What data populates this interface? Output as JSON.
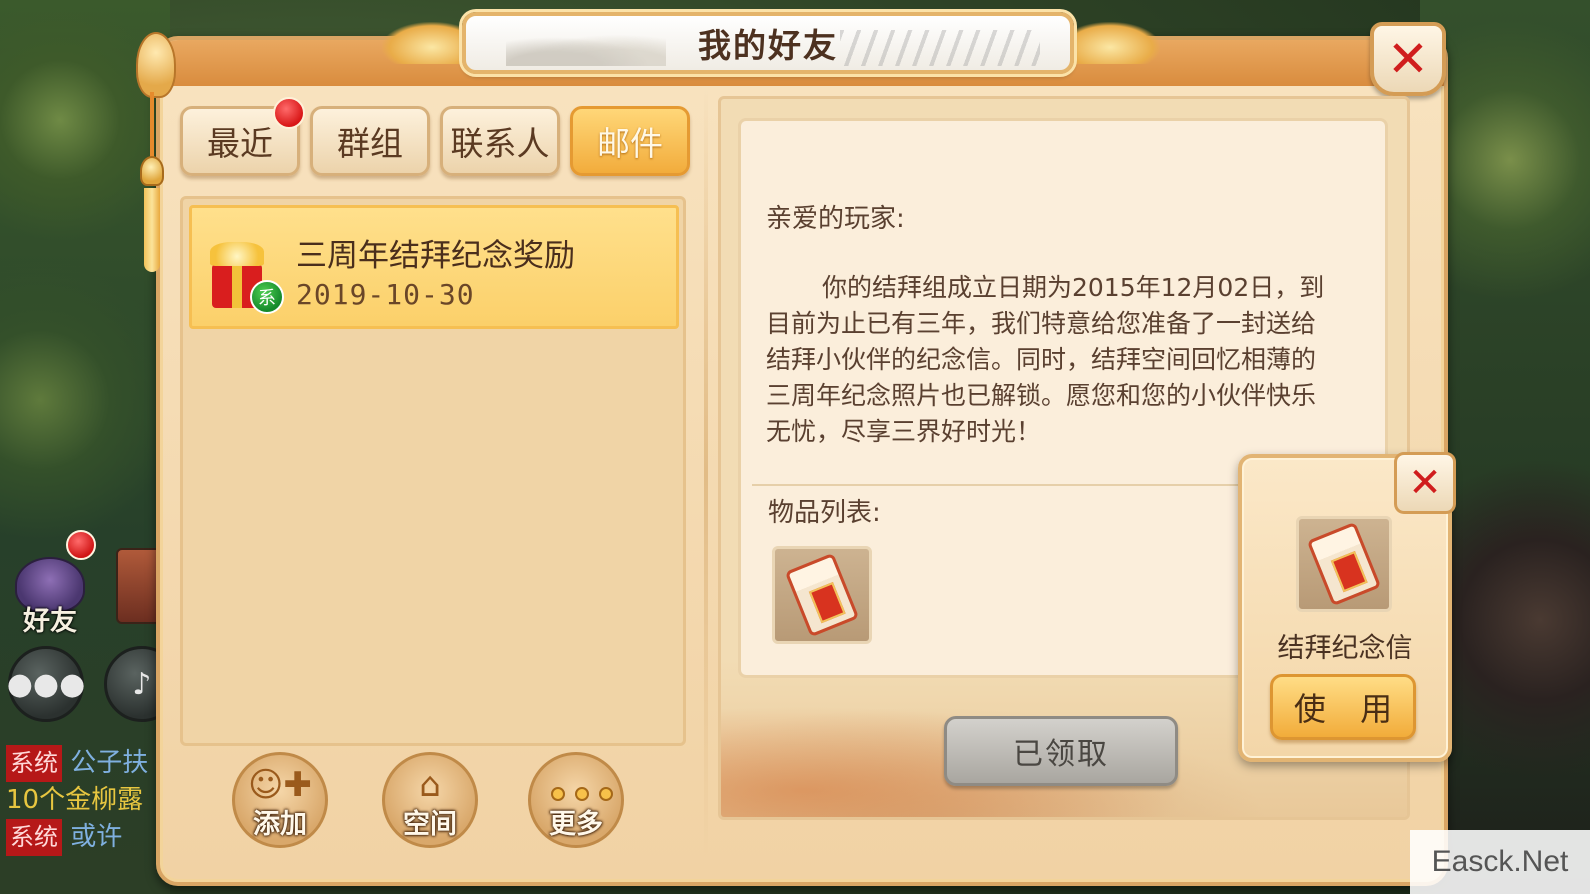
{
  "window": {
    "title": "我的好友"
  },
  "tabs": [
    {
      "label": "最近",
      "active": false,
      "has_badge": true
    },
    {
      "label": "群组",
      "active": false,
      "has_badge": false
    },
    {
      "label": "联系人",
      "active": false,
      "has_badge": false
    },
    {
      "label": "邮件",
      "active": true,
      "has_badge": false
    }
  ],
  "mail_list": [
    {
      "title": "三周年结拜纪念奖励",
      "date": "2019-10-30",
      "sender_tag": "系",
      "icon": "gift-icon"
    }
  ],
  "bottom_buttons": {
    "add": "添加",
    "space": "空间",
    "more": "更多"
  },
  "letter": {
    "greeting": "亲爱的玩家:",
    "body": "你的结拜组成立日期为2015年12月02日，到目前为止已有三年，我们特意给您准备了一封送给结拜小伙伴的纪念信。同时，结拜空间回忆相薄的三周年纪念照片也已解锁。愿您和您的小伙伴快乐无忧，尽享三界好时光！",
    "items_label": "物品列表:",
    "claim_button": "已领取"
  },
  "item_popup": {
    "name": "结拜纪念信",
    "use_button": "使 用",
    "icon": "scroll-icon"
  },
  "side_hud": {
    "friend_label": "好友",
    "chat_lines": [
      {
        "tag": "系统",
        "text": "公子扶"
      },
      {
        "tag": "",
        "text": "10个金柳露"
      },
      {
        "tag": "系统",
        "text": "或许"
      }
    ]
  },
  "watermark": "Easck.Net",
  "colors": {
    "accent_orange": "#f2ac3c",
    "close_red": "#d01d1d",
    "badge_red": "#d81616",
    "claimed_gray": "#a9a6a0"
  }
}
